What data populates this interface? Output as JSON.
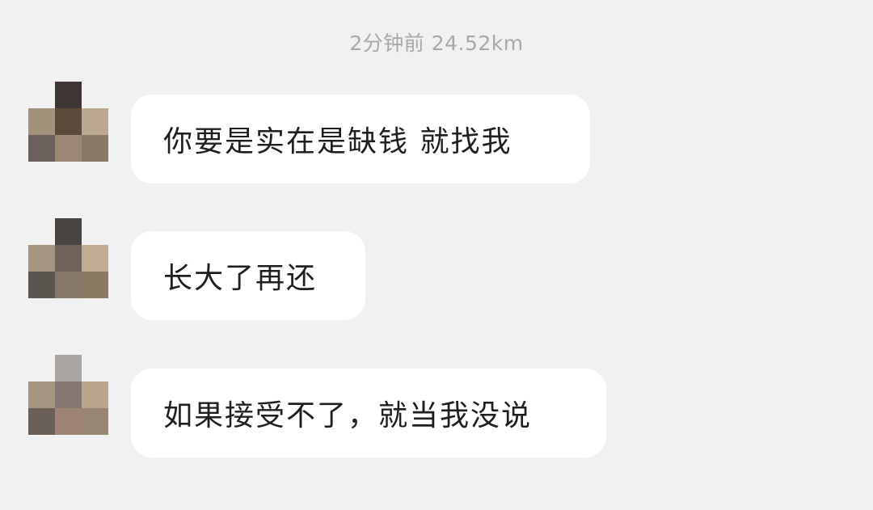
{
  "header": {
    "timestamp": "2分钟前 24.52km"
  },
  "messages": [
    {
      "text": "你要是实在是缺钱  就找我",
      "avatar_pixels": [
        [
          "",
          "#3f3533",
          ""
        ],
        [
          "#a3927a",
          "#5e4a3a",
          "#bca88f"
        ],
        [
          "#6b605b",
          "#9c8773",
          "#8a7a63"
        ]
      ]
    },
    {
      "text": "长大了再还",
      "avatar_pixels": [
        [
          "",
          "#4a4440",
          ""
        ],
        [
          "#a89580",
          "#6f6259",
          "#c0ad91"
        ],
        [
          "#5b5550",
          "#87786a",
          "#8b7a5f"
        ]
      ]
    },
    {
      "text": "如果接受不了，就当我没说",
      "avatar_pixels": [
        [
          "",
          "#a8a5a2",
          ""
        ],
        [
          "#a89580",
          "#857870",
          "#bba68c"
        ],
        [
          "#6a6058",
          "#9e8272",
          "#988670"
        ]
      ]
    }
  ]
}
